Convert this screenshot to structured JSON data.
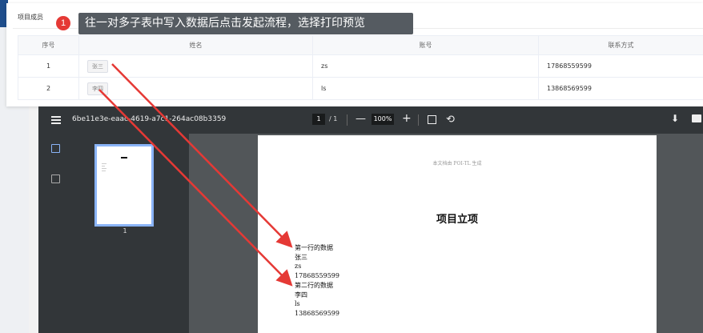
{
  "members": {
    "title": "项目成员",
    "columns": [
      "序号",
      "姓名",
      "账号",
      "联系方式"
    ],
    "rows": [
      {
        "index": "1",
        "name": "张三",
        "account": "zs",
        "phone": "17868559599"
      },
      {
        "index": "2",
        "name": "李四",
        "account": "ls",
        "phone": "13868569599"
      }
    ]
  },
  "callout": {
    "step": "1",
    "text": "往一对多子表中写入数据后点击发起流程，选择打印预览"
  },
  "pdf": {
    "doc_title": "6be11e3e-eaac-4619-a7c1-264ac08b3359",
    "page_current": "1",
    "page_separator": "/",
    "page_total": "1",
    "zoom_out": "—",
    "zoom": "100%",
    "zoom_in": "+",
    "rotate": "⟲",
    "download": "⬇",
    "thumbnail_label": "1",
    "page_header": "本文档由 POI-TL 生成",
    "page_title": "项目立项",
    "lines": [
      "第一行的数据",
      "张三",
      "zs",
      "17868559599",
      "第二行的数据",
      "李四",
      "ls",
      "13868569599"
    ]
  },
  "colors": {
    "accent": "#e53935",
    "arrow": "#e53935",
    "thumb_border": "#8ab4f8"
  }
}
